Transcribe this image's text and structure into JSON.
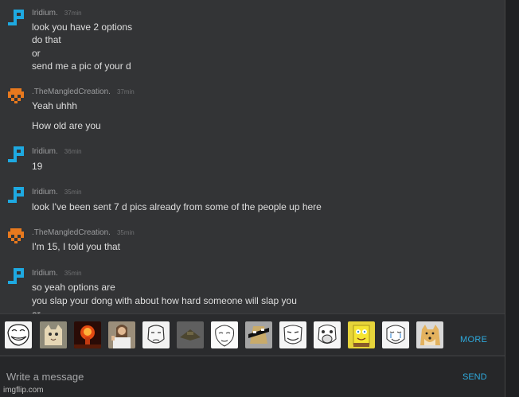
{
  "colors": {
    "background": "#333436",
    "accent": "#2eaadd",
    "iridium_avatar": "#1ea9e1",
    "mangled_avatar": "#e8791e"
  },
  "messages": [
    {
      "user": "Iridium.",
      "time": "37min",
      "avatar": "blue-pixel-avatar-icon",
      "lines": [
        "look you have 2 options",
        "do that",
        "or",
        "send me a pic of your d"
      ]
    },
    {
      "user": ".TheMangledCreation.",
      "time": "37min",
      "avatar": "orange-pixel-avatar-icon",
      "lines": [
        "Yeah uhhh",
        "How old are you"
      ]
    },
    {
      "user": "Iridium.",
      "time": "36min",
      "avatar": "blue-pixel-avatar-icon",
      "lines": [
        "19"
      ]
    },
    {
      "user": "Iridium.",
      "time": "35min",
      "avatar": "blue-pixel-avatar-icon",
      "lines": [
        "look I've been sent 7 d pics already from some of the people up here"
      ]
    },
    {
      "user": ".TheMangledCreation.",
      "time": "35min",
      "avatar": "orange-pixel-avatar-icon",
      "lines": [
        "I'm 15, I told you that"
      ]
    },
    {
      "user": "Iridium.",
      "time": "35min",
      "avatar": "blue-pixel-avatar-icon",
      "lines": [
        "so yeah options are",
        "you slap your dong with about how hard someone will slap you",
        "or"
      ]
    }
  ],
  "emoji_bar": {
    "memes": [
      "troll-face",
      "cat",
      "nuke-explosion",
      "jesus",
      "okay-face",
      "scumbag-hat",
      "me-gusta",
      "doge-glasses",
      "fuck-yea",
      "lol-face",
      "spongebob",
      "happy-cry-face",
      "doge"
    ],
    "more_label": "MORE"
  },
  "composer": {
    "placeholder": "Write a message",
    "send_label": "SEND"
  },
  "watermark": "imgflip.com"
}
